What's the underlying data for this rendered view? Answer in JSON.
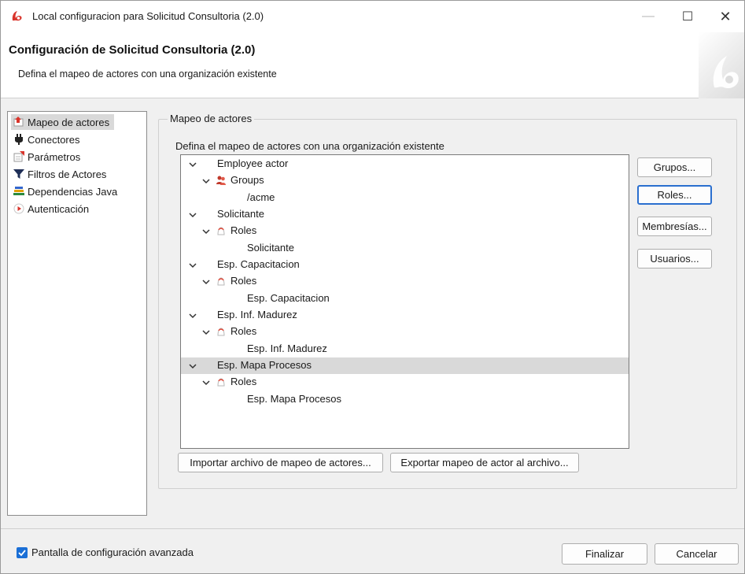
{
  "window": {
    "title": "Local configuracion para  Solicitud Consultoria (2.0)",
    "controls": {
      "minimize": "—",
      "maximize": "☐",
      "close": "✕"
    }
  },
  "header": {
    "title": "Configuración de Solicitud Consultoria (2.0)",
    "subtitle": "Defina el mapeo de actores con una organización existente"
  },
  "nav": {
    "items": [
      {
        "label": "Mapeo de actores",
        "icon": "actor-mapping-icon",
        "selected": true
      },
      {
        "label": "Conectores",
        "icon": "plug-icon"
      },
      {
        "label": "Parámetros",
        "icon": "parameters-icon"
      },
      {
        "label": "Filtros de Actores",
        "icon": "filter-icon"
      },
      {
        "label": "Dependencias Java",
        "icon": "java-dependencies-icon"
      },
      {
        "label": "Autenticación",
        "icon": "authentication-icon"
      }
    ]
  },
  "main": {
    "group_title": "Mapeo de actores",
    "caption": "Defina el mapeo de actores con una organización existente",
    "tree": [
      {
        "label": "Employee actor"
      },
      {
        "label": "Groups",
        "icon": "groups-icon"
      },
      {
        "label": "/acme"
      },
      {
        "label": "Solicitante"
      },
      {
        "label": "Roles",
        "icon": "role-icon"
      },
      {
        "label": "Solicitante"
      },
      {
        "label": "Esp. Capacitacion"
      },
      {
        "label": "Roles",
        "icon": "role-icon"
      },
      {
        "label": "Esp. Capacitacion"
      },
      {
        "label": "Esp. Inf. Madurez"
      },
      {
        "label": "Roles",
        "icon": "role-icon"
      },
      {
        "label": "Esp. Inf. Madurez"
      },
      {
        "label": "Esp. Mapa Procesos",
        "selected": true
      },
      {
        "label": "Roles",
        "icon": "role-icon"
      },
      {
        "label": "Esp. Mapa Procesos"
      }
    ],
    "side_buttons": {
      "groups": "Grupos...",
      "roles": "Roles...",
      "memberships": "Membresías...",
      "users": "Usuarios..."
    },
    "import_button": "Importar archivo de mapeo de actores...",
    "export_button": "Exportar mapeo de actor al archivo..."
  },
  "footer": {
    "advanced_label": "Pantalla de configuración avanzada",
    "advanced_checked": true,
    "finish_button": "Finalizar",
    "cancel_button": "Cancelar"
  },
  "colors": {
    "accent": "#2a6fcf",
    "brand_red": "#d9342b",
    "checkbox": "#1a6fd6",
    "selection": "#d9d9d9"
  }
}
